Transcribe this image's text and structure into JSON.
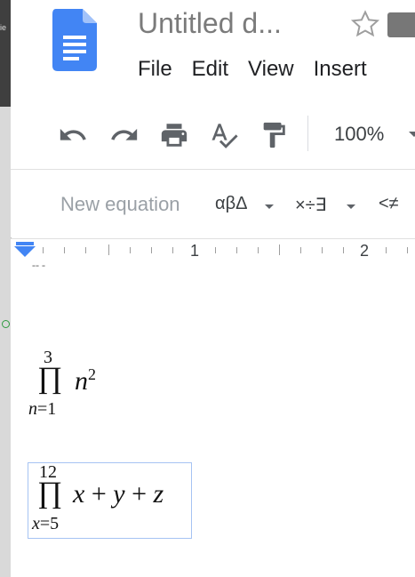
{
  "window": {
    "partial_side_label": "ie"
  },
  "header": {
    "doc_title": "Untitled d...",
    "star_icon": "star-outline-icon",
    "menu": [
      "File",
      "Edit",
      "View",
      "Insert"
    ]
  },
  "toolbar": {
    "icons": [
      "undo-icon",
      "redo-icon",
      "print-icon",
      "spellcheck-icon",
      "paint-format-icon"
    ],
    "zoom": "100%"
  },
  "equation_toolbar": {
    "new_equation": "New equation",
    "greek": "αβΔ",
    "operators": "×÷∃",
    "relations": "<≠"
  },
  "ruler": {
    "labels": [
      "1",
      "2"
    ]
  },
  "document": {
    "cut_text": "-- -",
    "eq1": {
      "upper": "3",
      "symbol": "∏",
      "lower_var": "n",
      "lower_eq": "=",
      "lower_val": "1",
      "body_var": "n",
      "body_exp": "2"
    },
    "eq2": {
      "upper": "12",
      "symbol": "∏",
      "lower_var": "x",
      "lower_eq": "=",
      "lower_val": "5",
      "t1": "x",
      "op1": "+",
      "t2": "y",
      "op2": "+",
      "t3": "z"
    }
  },
  "colors": {
    "accent": "#4285f4",
    "selection_border": "#a6c3f3",
    "docs_blue": "#4285f4"
  }
}
